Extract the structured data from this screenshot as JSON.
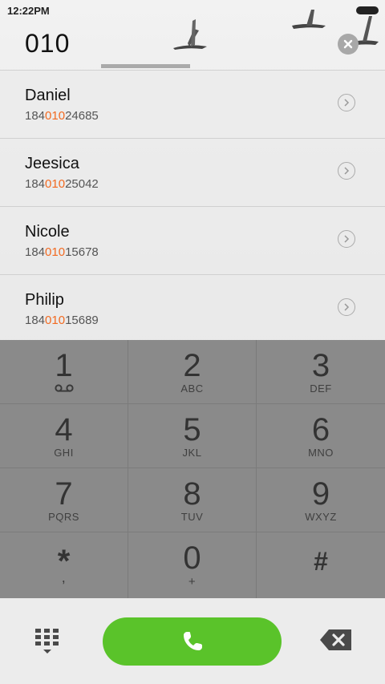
{
  "status": {
    "time": "12:22PM"
  },
  "dial": {
    "number": "010",
    "clear_icon": "close-circle-icon"
  },
  "contacts": [
    {
      "name": "Daniel",
      "prefix": "184",
      "match": "010",
      "suffix": "24685"
    },
    {
      "name": "Jeesica",
      "prefix": "184",
      "match": "010",
      "suffix": "25042"
    },
    {
      "name": "Nicole",
      "prefix": "184",
      "match": "010",
      "suffix": "15678"
    },
    {
      "name": "Philip",
      "prefix": "184",
      "match": "010",
      "suffix": "15689"
    }
  ],
  "keypad": [
    {
      "digit": "1",
      "letters": ""
    },
    {
      "digit": "2",
      "letters": "ABC"
    },
    {
      "digit": "3",
      "letters": "DEF"
    },
    {
      "digit": "4",
      "letters": "GHI"
    },
    {
      "digit": "5",
      "letters": "JKL"
    },
    {
      "digit": "6",
      "letters": "MNO"
    },
    {
      "digit": "7",
      "letters": "PQRS"
    },
    {
      "digit": "8",
      "letters": "TUV"
    },
    {
      "digit": "9",
      "letters": "WXYZ"
    },
    {
      "digit": "*",
      "letters": ","
    },
    {
      "digit": "0",
      "letters": "+"
    },
    {
      "digit": "#",
      "letters": ""
    }
  ],
  "colors": {
    "highlight": "#f26a21",
    "call": "#5ac32a",
    "keypad_bg": "#8a8a8a"
  },
  "icons": {
    "voicemail": "voicemail-icon",
    "call": "phone-icon",
    "keypad_toggle": "dialpad-icon",
    "delete": "backspace-icon",
    "detail": "chevron-right-icon"
  }
}
